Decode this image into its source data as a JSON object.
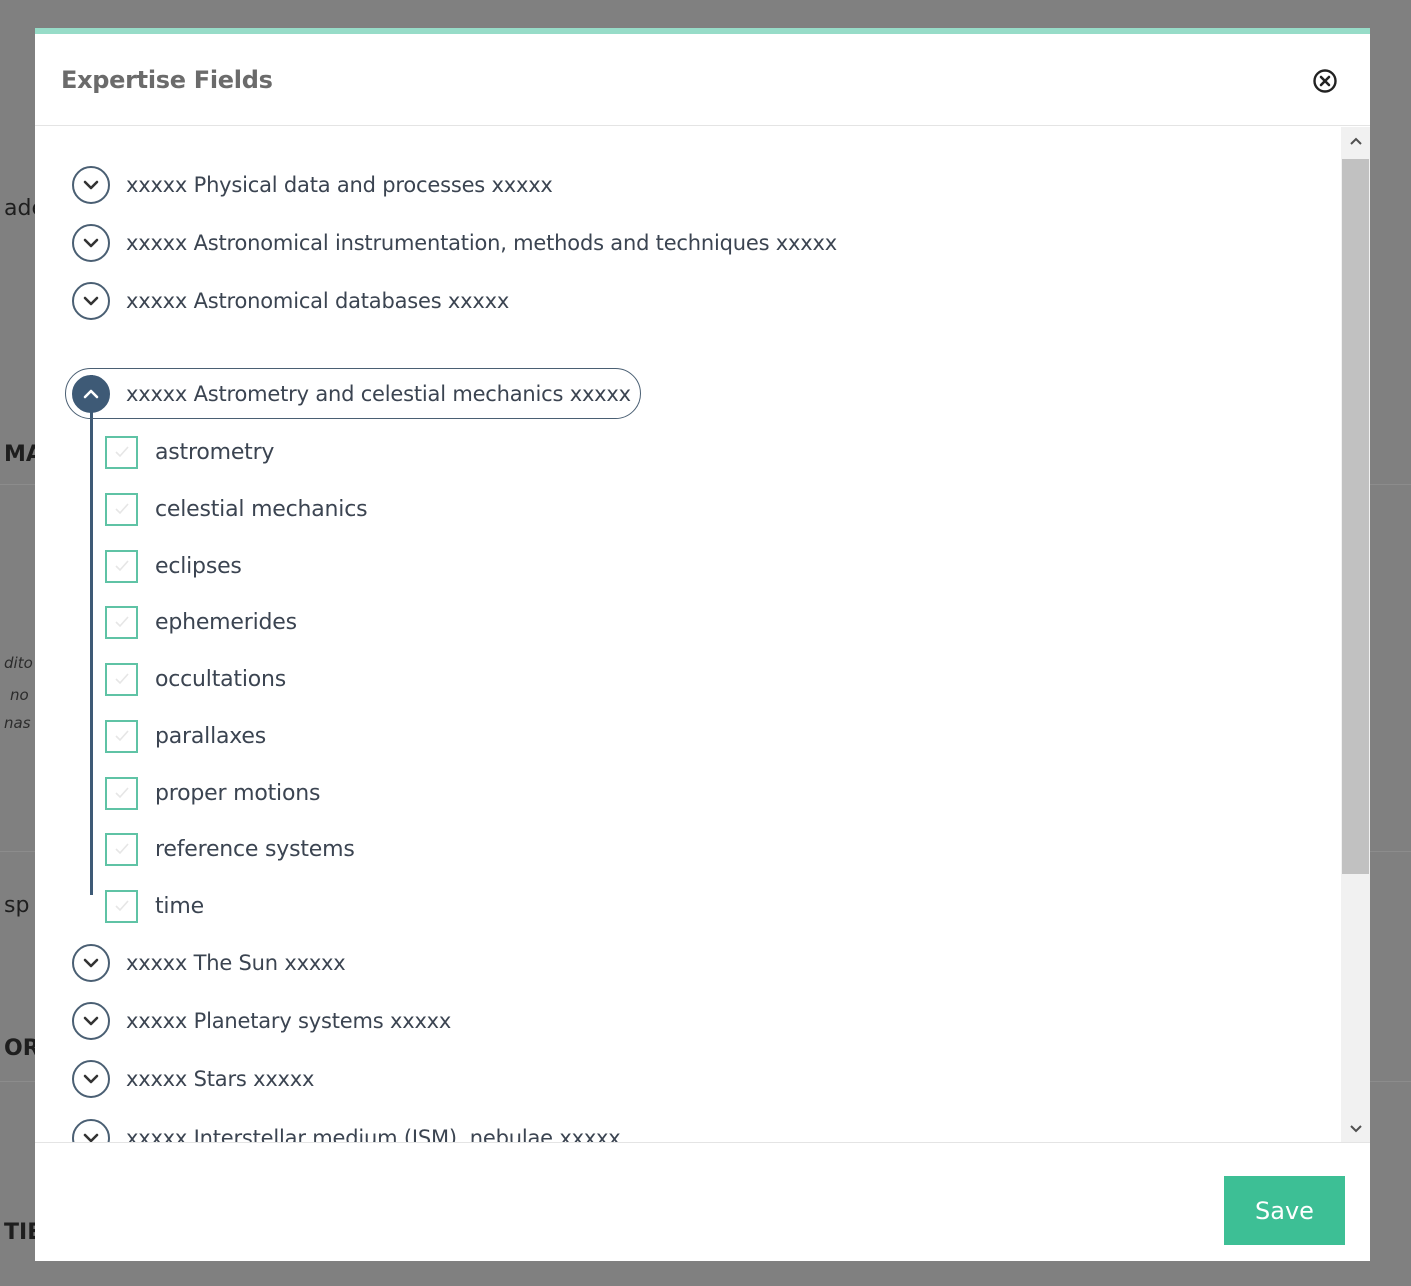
{
  "background": {
    "fragments": [
      "ade",
      "MA",
      "dito",
      "no",
      "nas",
      "sp",
      "ORI",
      "TIES"
    ]
  },
  "modal": {
    "title": "Expertise Fields",
    "accent_color": "#97dcc8",
    "close_icon": "close-circle-icon",
    "save_label": "Save",
    "save_color": "#3dbf95"
  },
  "tree": {
    "groups_before": [
      {
        "label": "xxxxx Physical data and processes xxxxx",
        "icon": "chevron-down-icon"
      },
      {
        "label": "xxxxx Astronomical instrumentation, methods and techniques xxxxx",
        "icon": "chevron-down-icon"
      },
      {
        "label": "xxxxx Astronomical databases xxxxx",
        "icon": "chevron-down-icon"
      }
    ],
    "expanded_group": {
      "label": "xxxxx Astrometry and celestial mechanics xxxxx",
      "icon": "chevron-up-icon",
      "children": [
        {
          "label": "astrometry",
          "checked": false
        },
        {
          "label": "celestial mechanics",
          "checked": false
        },
        {
          "label": "eclipses",
          "checked": false
        },
        {
          "label": "ephemerides",
          "checked": false
        },
        {
          "label": "occultations",
          "checked": false
        },
        {
          "label": "parallaxes",
          "checked": false
        },
        {
          "label": "proper motions",
          "checked": false
        },
        {
          "label": "reference systems",
          "checked": false
        },
        {
          "label": "time",
          "checked": false
        }
      ]
    },
    "groups_after": [
      {
        "label": "xxxxx The Sun xxxxx",
        "icon": "chevron-down-icon"
      },
      {
        "label": "xxxxx Planetary systems xxxxx",
        "icon": "chevron-down-icon"
      },
      {
        "label": "xxxxx Stars xxxxx",
        "icon": "chevron-down-icon"
      },
      {
        "label": "xxxxx Interstellar medium (ISM), nebulae xxxxx",
        "icon": "chevron-down-icon"
      }
    ]
  }
}
